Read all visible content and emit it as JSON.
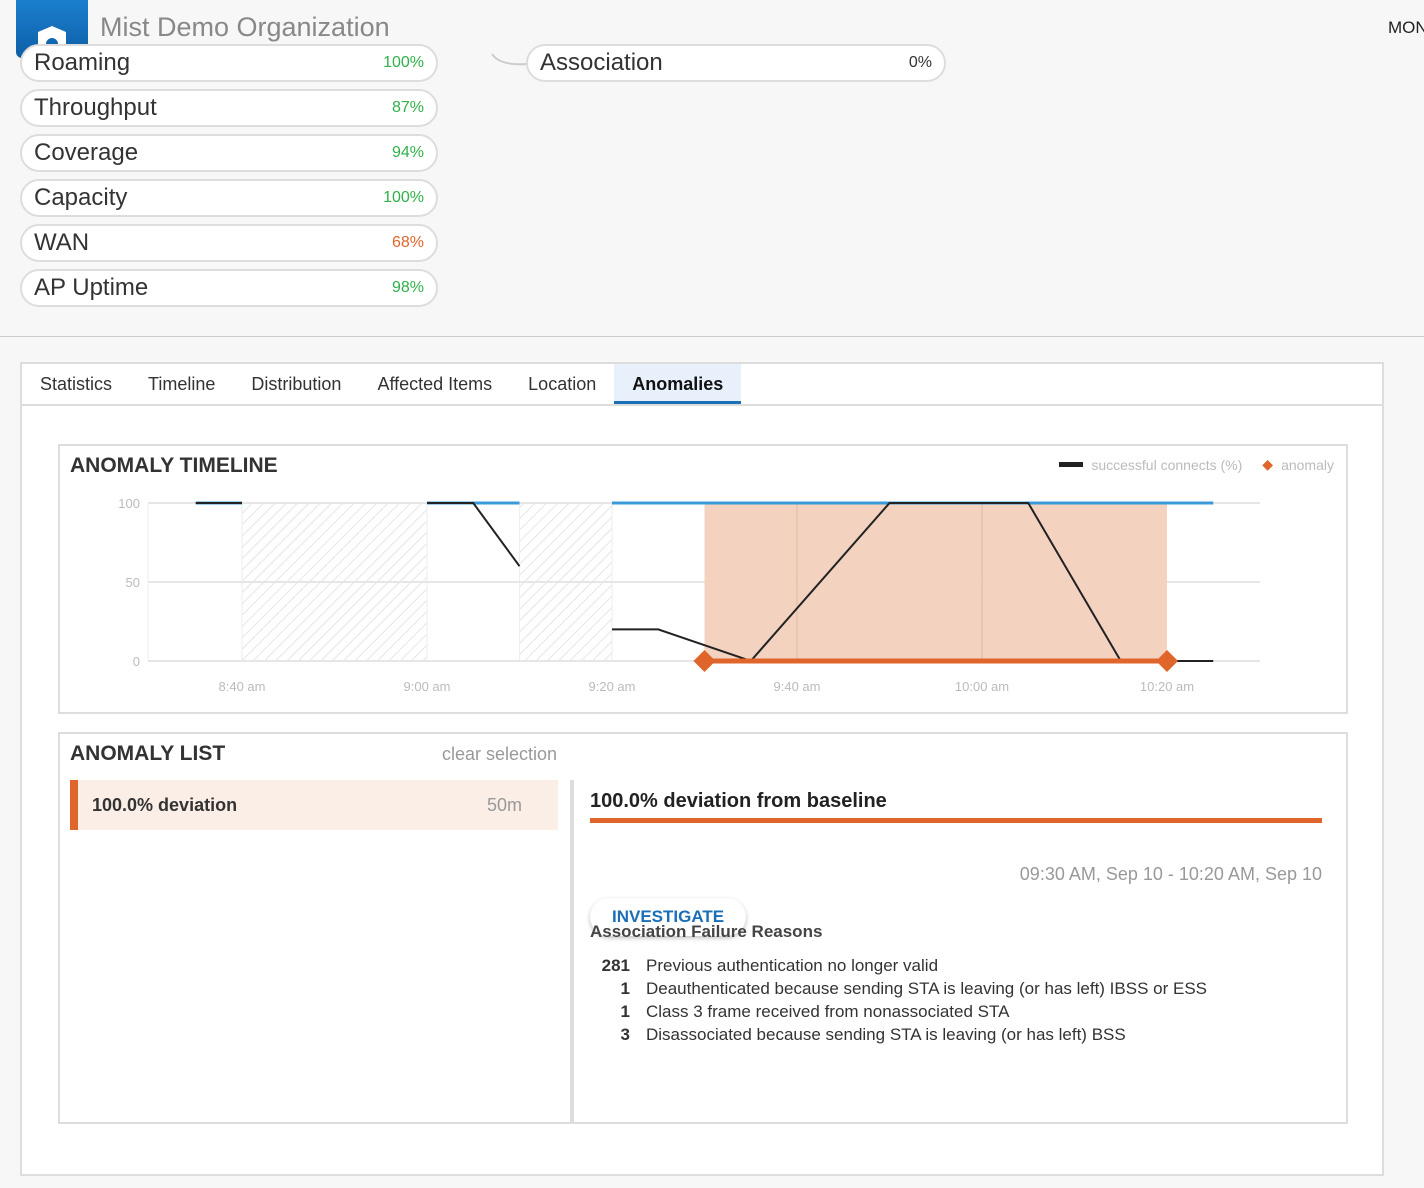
{
  "header": {
    "org_name": "Mist Demo Organization",
    "right_label": "MON"
  },
  "metrics_left": [
    {
      "label": "Roaming",
      "value": "100%",
      "color": "#2fb04a"
    },
    {
      "label": "Throughput",
      "value": "87%",
      "color": "#2fb04a"
    },
    {
      "label": "Coverage",
      "value": "94%",
      "color": "#2fb04a"
    },
    {
      "label": "Capacity",
      "value": "100%",
      "color": "#2fb04a"
    },
    {
      "label": "WAN",
      "value": "68%",
      "color": "#e0652a"
    },
    {
      "label": "AP Uptime",
      "value": "98%",
      "color": "#2fb04a"
    }
  ],
  "metrics_right": [
    {
      "label": "Association",
      "value": "0%",
      "color": "#333"
    }
  ],
  "tabs": [
    "Statistics",
    "Timeline",
    "Distribution",
    "Affected Items",
    "Location",
    "Anomalies"
  ],
  "timeline": {
    "title": "ANOMALY TIMELINE",
    "legend_series": "successful connects (%)",
    "legend_anomaly": "anomaly"
  },
  "chart_data": {
    "type": "line",
    "title": "ANOMALY TIMELINE",
    "ylim": [
      0,
      100
    ],
    "yticks": [
      "100",
      "50",
      "0"
    ],
    "xticks": [
      "8:40 am",
      "9:00 am",
      "9:20 am",
      "9:40 am",
      "10:00 am",
      "10:20 am"
    ],
    "x_unit": "minutes since 8:40 am",
    "series": [
      {
        "name": "successful connects (%)",
        "segments": [
          [
            [
              -5,
              100
            ],
            [
              0,
              100
            ]
          ],
          [
            [
              20,
              100
            ],
            [
              25,
              100
            ],
            [
              30,
              60
            ]
          ],
          [
            [
              40,
              20
            ],
            [
              45,
              20
            ],
            [
              55,
              0
            ],
            [
              70,
              100
            ],
            [
              85,
              100
            ],
            [
              95,
              0
            ],
            [
              105,
              0
            ]
          ]
        ]
      }
    ],
    "baseline": [
      [
        -5,
        0
      ],
      [
        20,
        30
      ],
      [
        40,
        105
      ]
    ],
    "no_data": [
      [
        0,
        20
      ],
      [
        30,
        40
      ]
    ],
    "anomaly": [
      50,
      100
    ],
    "colors": {
      "line": "#222",
      "baseline": "#3a9ad9",
      "anomaly": "#e0652a",
      "band": "#f2d0bd"
    }
  },
  "list": {
    "title": "ANOMALY LIST",
    "clear": "clear selection",
    "items": [
      {
        "label": "100.0% deviation",
        "duration": "50m"
      }
    ]
  },
  "detail": {
    "title": "100.0% deviation from baseline",
    "investigate": "INVESTIGATE",
    "range": "09:30 AM, Sep 10 - 10:20 AM, Sep 10",
    "reasons_title": "Association Failure Reasons",
    "reasons": [
      {
        "count": "281",
        "text": "Previous authentication no longer valid"
      },
      {
        "count": "1",
        "text": "Deauthenticated because sending STA is leaving (or has left) IBSS or ESS"
      },
      {
        "count": "1",
        "text": "Class 3 frame received from nonassociated STA"
      },
      {
        "count": "3",
        "text": "Disassociated because sending STA is leaving (or has left) BSS"
      }
    ]
  }
}
